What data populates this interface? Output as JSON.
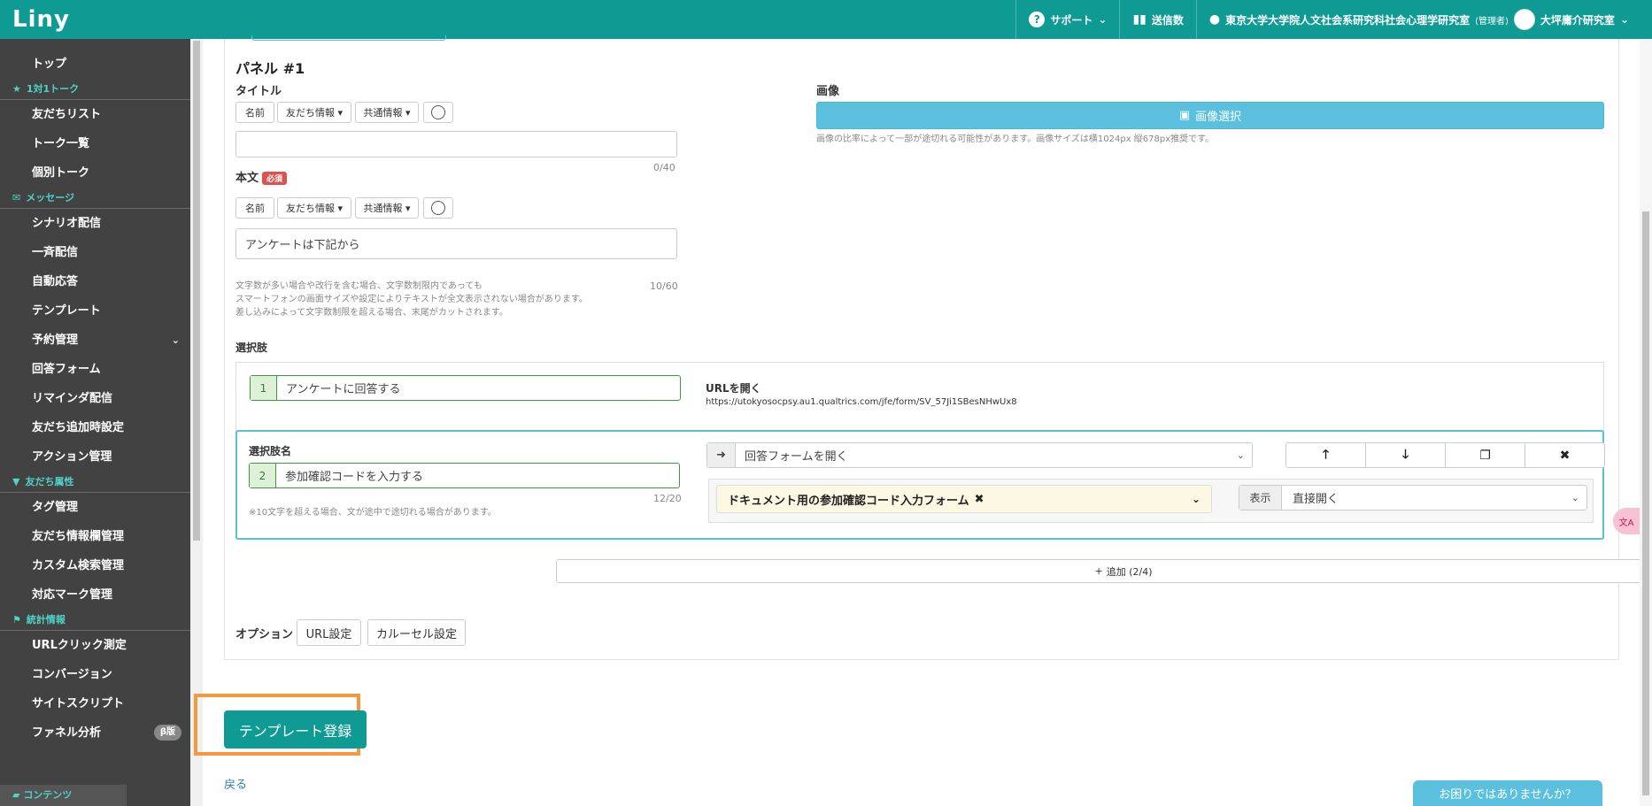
{
  "topbar": {
    "logo": "Liny",
    "support": "サポート",
    "send_count": "送信数",
    "account_name": "東京大学大学院人文社会系研究科社会心理学研究室",
    "account_role": "(管理者)",
    "lab_name": "大坪庸介研究室"
  },
  "sidebar": {
    "top": "トップ",
    "talk_head": "1対1トーク",
    "friend_list": "友だちリスト",
    "talk_list": "トーク一覧",
    "individual_talk": "個別トーク",
    "message_head": "メッセージ",
    "scenario": "シナリオ配信",
    "broadcast": "一斉配信",
    "auto_reply": "自動応答",
    "template": "テンプレート",
    "reservation": "予約管理",
    "answer_form": "回答フォーム",
    "reminder": "リマインダ配信",
    "friend_add_settings": "友だち追加時設定",
    "action_mgmt": "アクション管理",
    "friend_attr_head": "友だち属性",
    "tag_mgmt": "タグ管理",
    "friend_info_mgmt": "友だち情報欄管理",
    "custom_search": "カスタム検索管理",
    "mark_mgmt": "対応マーク管理",
    "stats_head": "統計情報",
    "url_click": "URLクリック測定",
    "conversion": "コンバージョン",
    "site_script": "サイトスクリプト",
    "funnel": "ファネル分析",
    "beta": "β版",
    "content_head": "コンテンツ"
  },
  "panel": {
    "title": "パネル #1",
    "title_label": "タイトル",
    "btn_name": "名前",
    "btn_friend_info": "友だち情報 ▾",
    "btn_common_info": "共通情報 ▾",
    "title_value": "",
    "title_count": "0/40",
    "body_label": "本文",
    "required": "必須",
    "body_value": "アンケートは下記から",
    "body_count": "10/60",
    "body_note_1": "文字数が多い場合や改行を含む場合、文字数制限内であっても",
    "body_note_2": "スマートフォンの画面サイズや設定によりテキストが全文表示されない場合があります。",
    "body_note_3": "差し込みによって文字数制限を超える場合、末尾がカットされます。",
    "image_label": "画像",
    "image_button": "画像選択",
    "image_note": "画像の比率によって一部が途切れる可能性があります。画像サイズは横1024px 縦678px推奨です。",
    "choices_label": "選択肢"
  },
  "choices": [
    {
      "num": "1",
      "text": "アンケートに回答する",
      "action_title": "URLを開く",
      "url": "https://utokyosocpsy.au1.qualtrics.com/jfe/form/SV_57Ji1SBesNHwUx8"
    },
    {
      "name_label": "選択肢名",
      "num": "2",
      "text": "参加確認コードを入力する",
      "count": "12/20",
      "note": "※10文字を超える場合、文が途中で途切れる場合があります。",
      "action": "回答フォームを開く",
      "form": "ドキュメント用の参加確認コード入力フォーム",
      "display_label": "表示",
      "display_value": "直接開く"
    }
  ],
  "add_button": "追加 (2/4)",
  "options": {
    "label": "オプション",
    "url_settings": "URL設定",
    "carousel_settings": "カルーセル設定"
  },
  "submit": "テンプレート登録",
  "back": "戻る",
  "help": "お困りではありませんか？"
}
